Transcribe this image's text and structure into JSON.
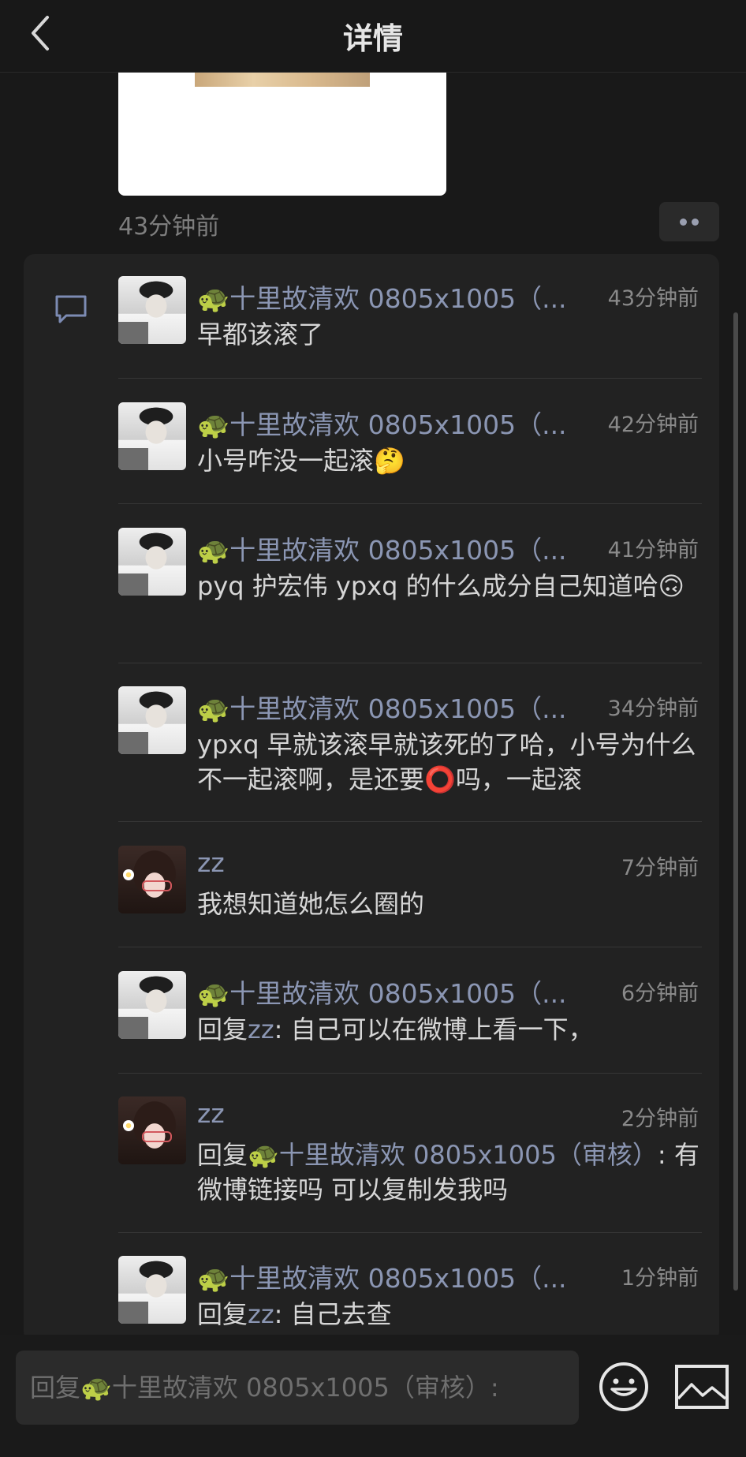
{
  "header": {
    "title": "详情",
    "back_icon": "chevron-left-icon"
  },
  "post": {
    "time": "43分钟前",
    "more_icon": "more-dots-icon"
  },
  "comments": [
    {
      "avatar": "guy",
      "name": "🐢十里故清欢 0805x1005（...",
      "time": "43分钟前",
      "text": "早都该滚了"
    },
    {
      "avatar": "guy",
      "name": "🐢十里故清欢 0805x1005（...",
      "time": "42分钟前",
      "text": "小号咋没一起滚🤔"
    },
    {
      "avatar": "guy",
      "name": "🐢十里故清欢 0805x1005（...",
      "time": "41分钟前",
      "text": "pyq 护宏伟 ypxq 的什么成分自己知道哈🙃"
    },
    {
      "avatar": "guy",
      "name": "🐢十里故清欢 0805x1005（...",
      "time": "34分钟前",
      "text": "ypxq 早就该滚早就该死的了哈，小号为什么不一起滚啊，是还要⭕吗，一起滚"
    },
    {
      "avatar": "girl",
      "name": "zz",
      "time": "7分钟前",
      "text": "我想知道她怎么圈的"
    },
    {
      "avatar": "guy",
      "name": "🐢十里故清欢 0805x1005（...",
      "time": "6分钟前",
      "reply_prefix": "回复",
      "reply_to": "zz",
      "text": ": 自己可以在微博上看一下，"
    },
    {
      "avatar": "girl",
      "name": "zz",
      "time": "2分钟前",
      "reply_prefix": "回复",
      "reply_to": "🐢十里故清欢 0805x1005（审核）",
      "text": ": 有微博链接吗 可以复制发我吗"
    },
    {
      "avatar": "guy",
      "name": "🐢十里故清欢 0805x1005（...",
      "time": "1分钟前",
      "reply_prefix": "回复",
      "reply_to": "zz",
      "text": ": 自己去查"
    }
  ],
  "bottom": {
    "input_placeholder": "回复🐢十里故清欢 0805x1005（审核）:",
    "emoji_icon": "smiley-icon",
    "image_icon": "image-icon"
  },
  "colors": {
    "background": "#191919",
    "panel": "#222222",
    "name_accent": "#8b96b3"
  }
}
